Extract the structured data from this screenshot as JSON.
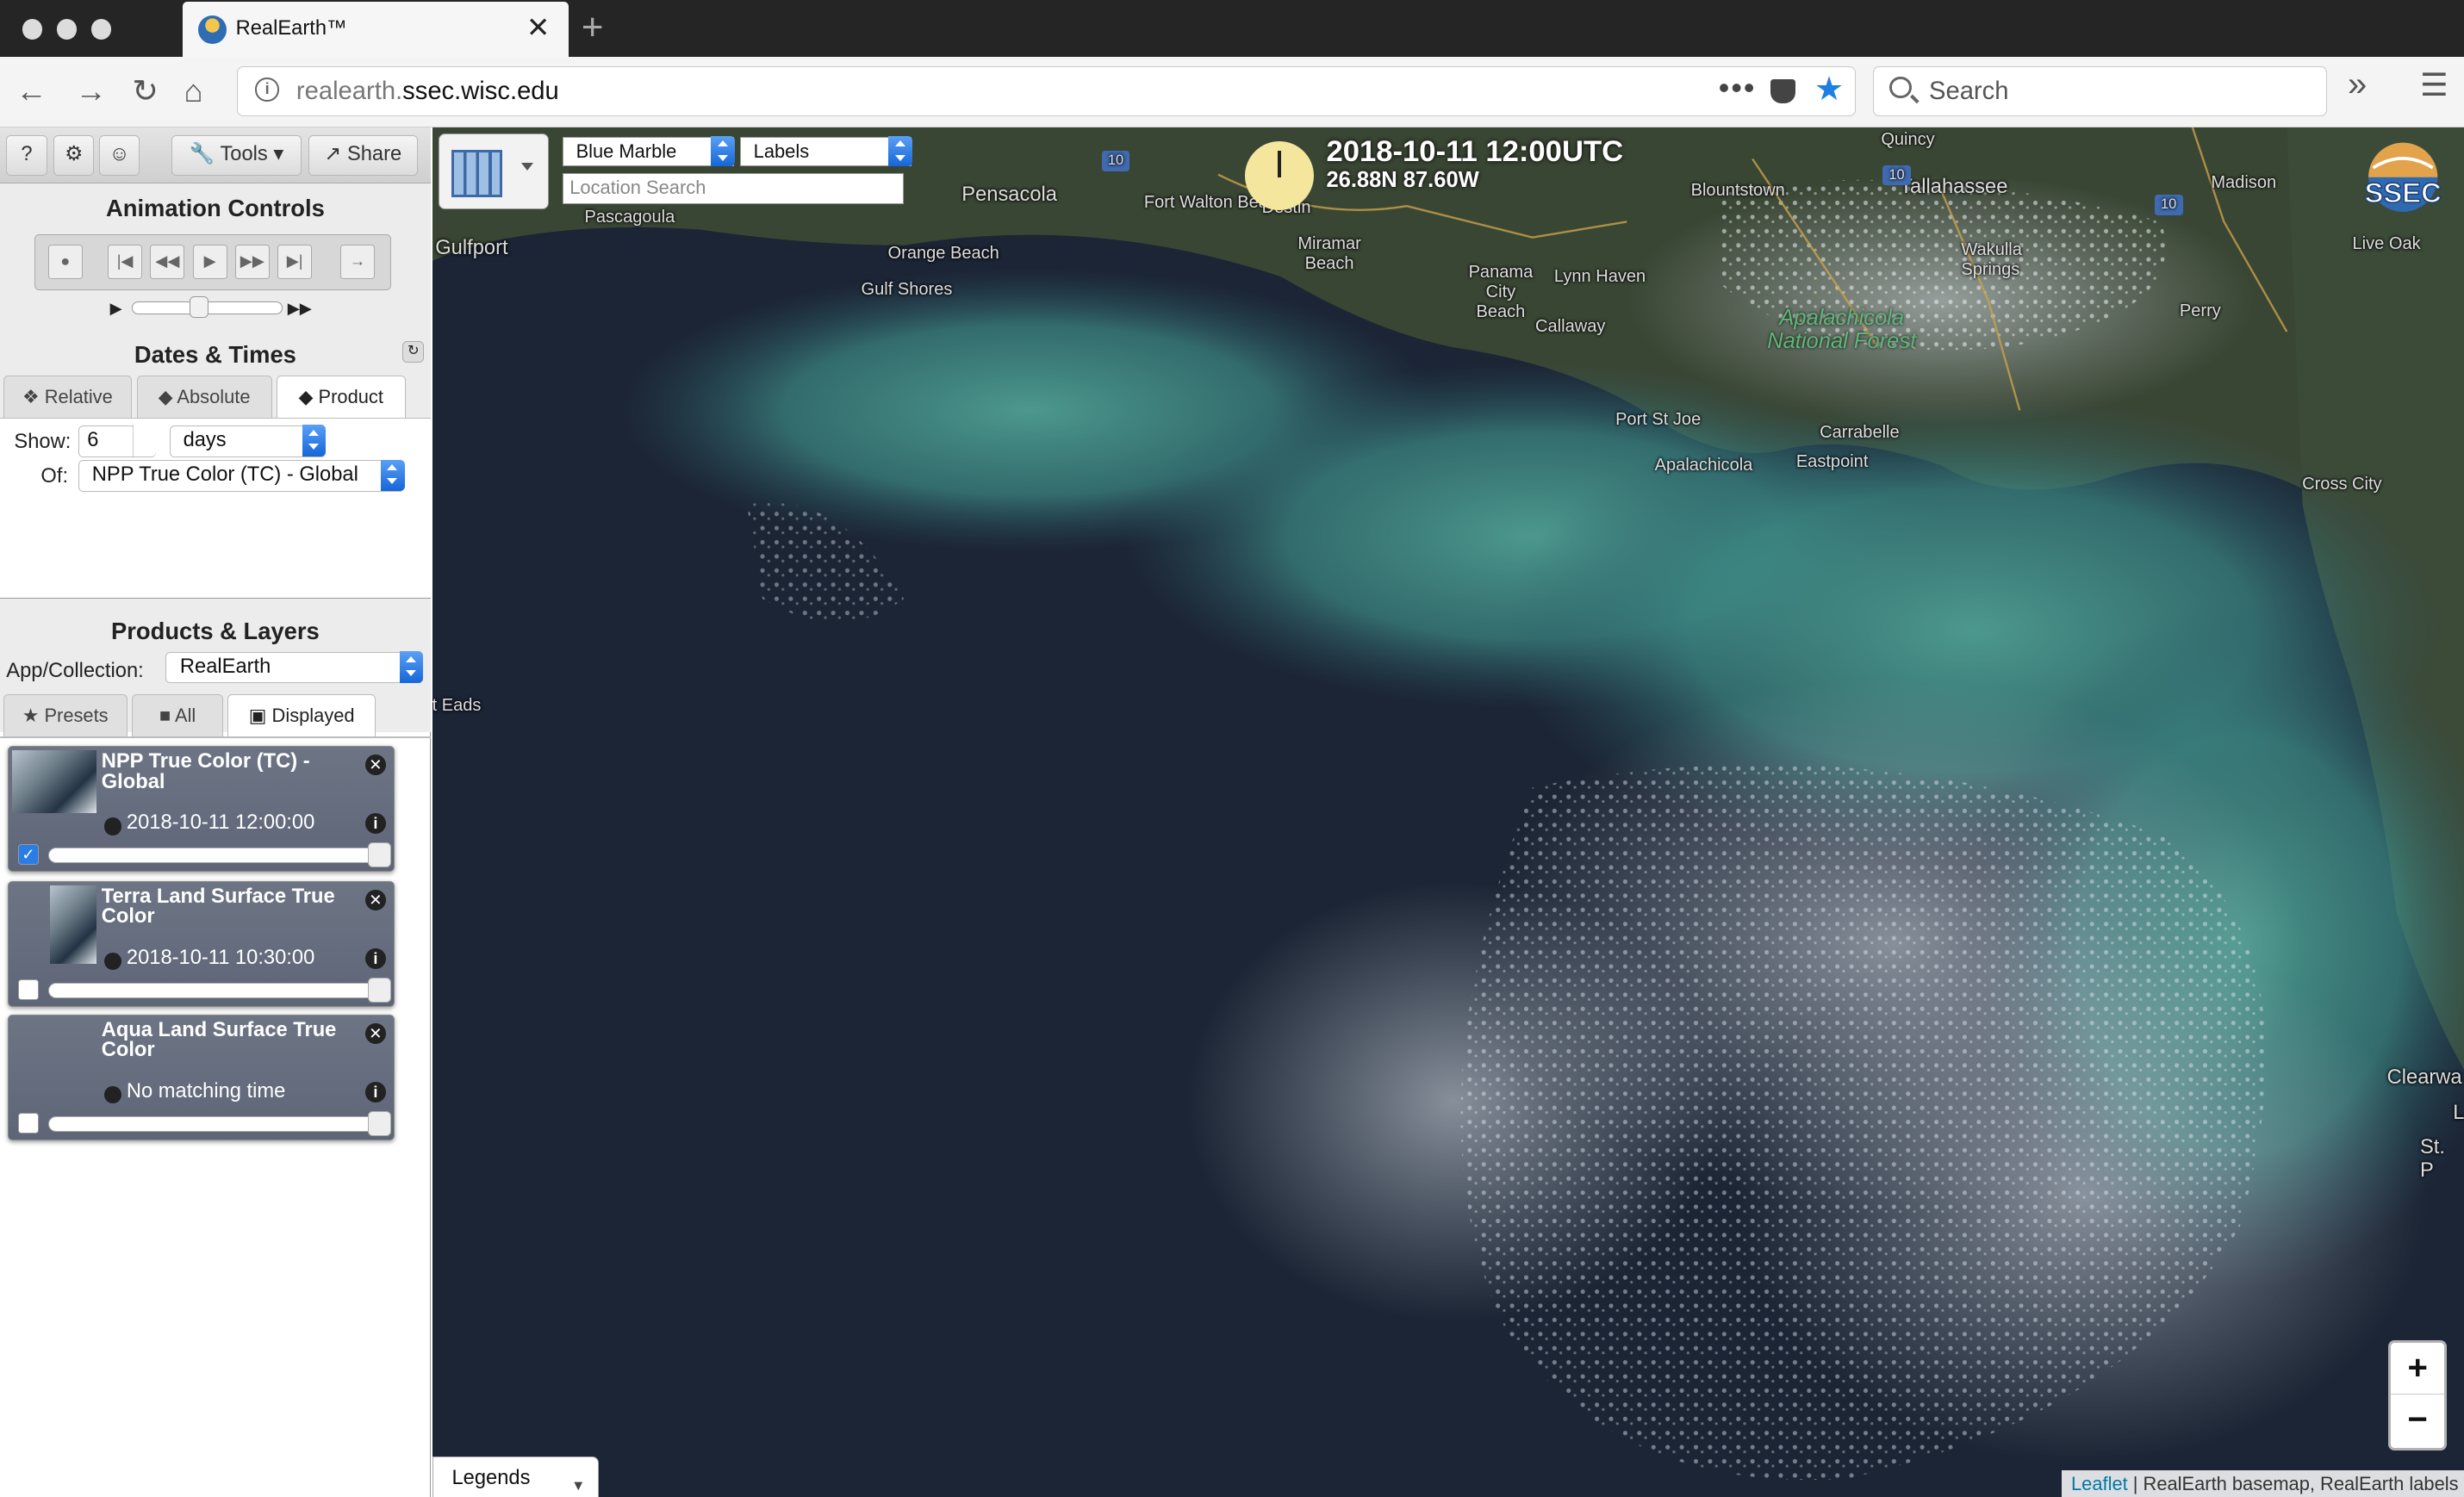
{
  "browser": {
    "tab_title": "RealEarth™",
    "url_host_prefix": "realearth.",
    "url_host_main": "ssec.wisc.edu",
    "search_placeholder": "Search",
    "new_tab": "+",
    "tab_close": "✕"
  },
  "toolbar": {
    "help": "?",
    "tools": "Tools",
    "share": "Share"
  },
  "animation": {
    "title": "Animation Controls"
  },
  "dates": {
    "title": "Dates & Times",
    "tabs": [
      "Relative",
      "Absolute",
      "Product"
    ],
    "active_tab": "Product",
    "show_label": "Show:",
    "show_value": "6",
    "unit_value": "days",
    "of_label": "Of:",
    "of_value": "NPP True Color (TC) - Global"
  },
  "products": {
    "title": "Products & Layers",
    "collection_label": "App/Collection:",
    "collection_value": "RealEarth",
    "tabs": [
      "Presets",
      "All",
      "Displayed"
    ],
    "active_tab": "Displayed",
    "layers": [
      {
        "name": "NPP True Color (TC) - Global",
        "time": "2018-10-11 12:00:00",
        "checked": true
      },
      {
        "name": "Terra Land Surface True Color",
        "time": "2018-10-11 10:30:00",
        "checked": false
      },
      {
        "name": "Aqua Land Surface True Color",
        "time": "No matching time",
        "checked": false
      }
    ]
  },
  "map": {
    "basemap": "Blue Marble",
    "labels": "Labels",
    "location_search_placeholder": "Location Search",
    "datetime": "2018-10-11 12:00UTC",
    "coordinates": "26.88N 87.60W",
    "logo_text": "SSEC",
    "zoom_in": "+",
    "zoom_out": "−",
    "legends": "Legends",
    "attribution_link": "Leaflet",
    "attribution_text": " | RealEarth basemap, RealEarth labels",
    "place_labels": [
      "Gulfport",
      "Pascagoula",
      "Pensacola",
      "Fort Walton Beach",
      "Destin",
      "Orange Beach",
      "Gulf Shores",
      "Miramar Beach",
      "Panama City Beach",
      "Lynn Haven",
      "Callaway",
      "Blountstown",
      "Tallahassee",
      "Quincy",
      "Wakulla Springs",
      "Madison",
      "Live Oak",
      "Perry",
      "Port St Joe",
      "Carrabelle",
      "Apalachicola",
      "Eastpoint",
      "Cross City",
      "t Eads",
      "Clearwa",
      "St. P",
      "L"
    ],
    "forest_label": "Apalachicola National Forest",
    "highway_shields": [
      "10",
      "10",
      "10"
    ]
  },
  "colors": {
    "accent_blue": "#1d7fe3",
    "card_bg": "#646c7d",
    "map_ocean_dark": "#1b2433"
  }
}
